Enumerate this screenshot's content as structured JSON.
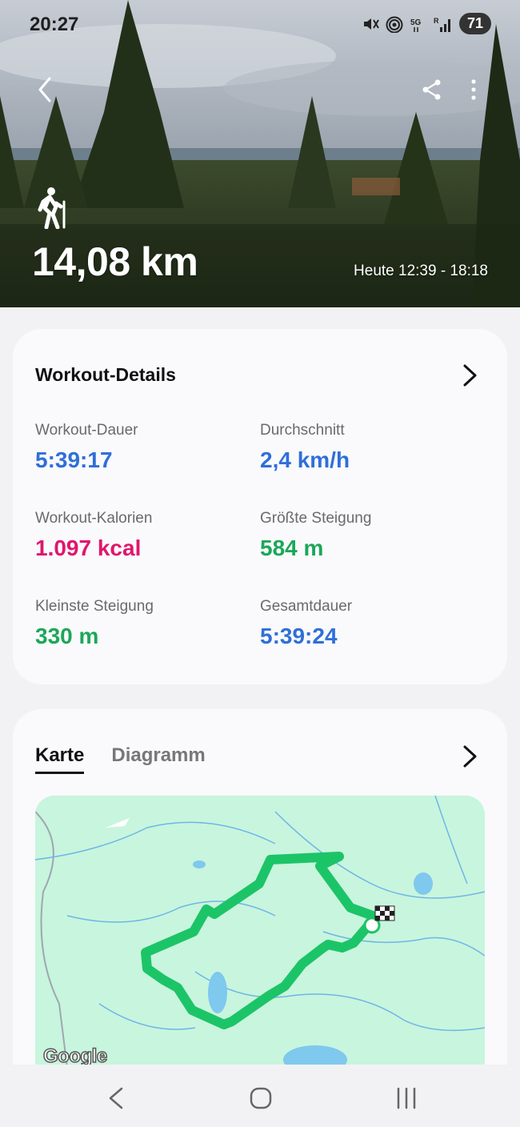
{
  "status_bar": {
    "time": "20:27",
    "battery": "71"
  },
  "hero": {
    "distance": "14,08 km",
    "time_range": "Heute 12:39 - 18:18",
    "activity_icon": "hiking-icon"
  },
  "workout_details": {
    "title": "Workout-Details",
    "metrics": [
      {
        "label": "Workout-Dauer",
        "value": "5:39:17",
        "color": "#2f6fd8"
      },
      {
        "label": "Durchschnitt",
        "value": "2,4 km/h",
        "color": "#2f6fd8"
      },
      {
        "label": "Workout-Kalorien",
        "value": "1.097 kcal",
        "color": "#e0166c"
      },
      {
        "label": "Größte Steigung",
        "value": "584 m",
        "color": "#1ca758"
      },
      {
        "label": "Kleinste Steigung",
        "value": "330 m",
        "color": "#1ca758"
      },
      {
        "label": "Gesamtdauer",
        "value": "5:39:24",
        "color": "#2f6fd8"
      }
    ]
  },
  "map_card": {
    "tabs": [
      {
        "label": "Karte",
        "active": true
      },
      {
        "label": "Diagramm",
        "active": false
      }
    ],
    "attribution": "Google",
    "route_color": "#1cc468"
  }
}
